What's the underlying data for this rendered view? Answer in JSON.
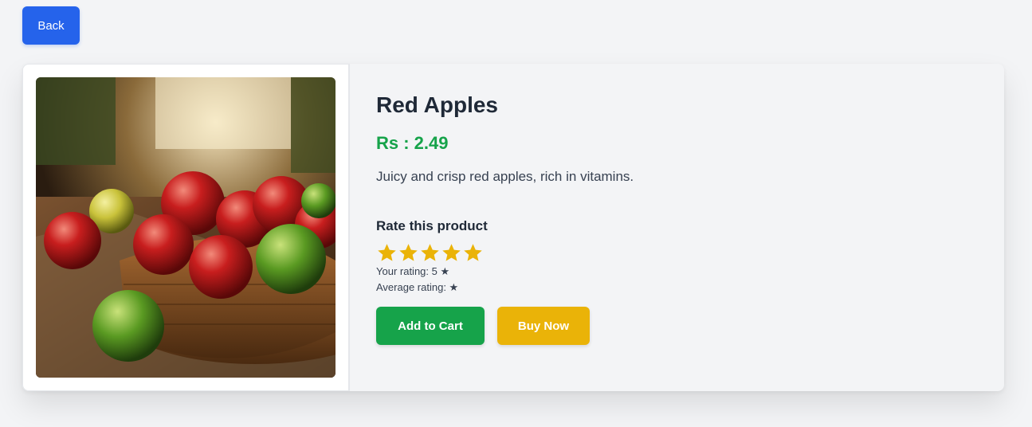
{
  "nav": {
    "back_label": "Back"
  },
  "product": {
    "name": "Red Apples",
    "price": "Rs : 2.49",
    "description": "Juicy and crisp red apples, rich in vitamins."
  },
  "rating": {
    "heading": "Rate this product",
    "stars_filled": 5,
    "stars_total": 5,
    "your_rating": "Your rating: 5 ★",
    "average_rating": "Average rating: ★"
  },
  "actions": {
    "add_to_cart_label": "Add to Cart",
    "buy_now_label": "Buy Now"
  },
  "colors": {
    "primary": "#2563eb",
    "price": "#16a34a",
    "cart": "#16a34a",
    "buy": "#eab308",
    "star": "#eab308"
  },
  "icons": {
    "star": "star-icon"
  }
}
